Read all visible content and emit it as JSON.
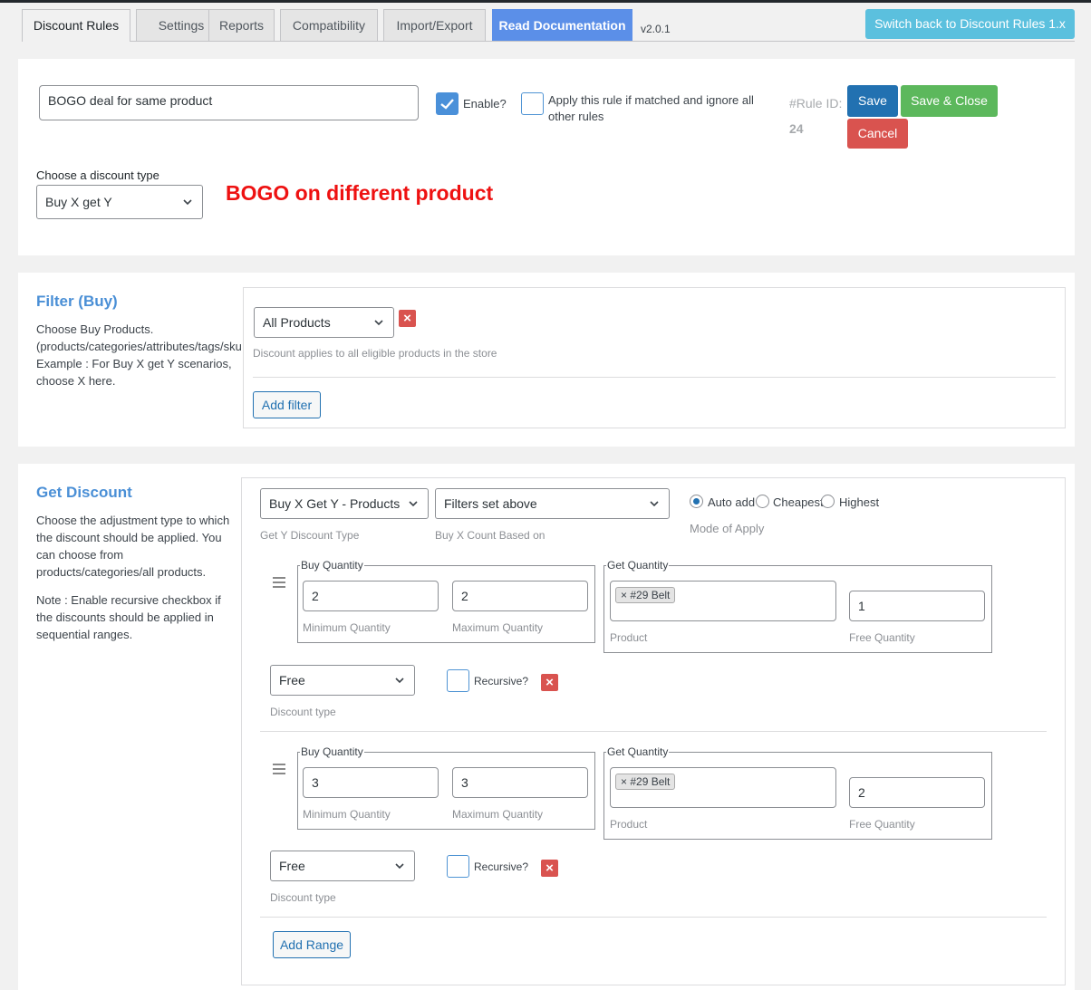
{
  "tabs": [
    {
      "label": "Discount Rules"
    },
    {
      "label": "Settings"
    },
    {
      "label": "Reports"
    },
    {
      "label": "Compatibility"
    },
    {
      "label": "Import/Export"
    },
    {
      "label": "Read Documentation"
    }
  ],
  "version": "v2.0.1",
  "switch_label": "Switch back to Discount Rules 1.x",
  "rule": {
    "name_value": "BOGO deal for same product",
    "enable_label": "Enable?",
    "enabled": true,
    "exclusive_label": "Apply this rule if matched and ignore all other rules",
    "rule_id_label": "#Rule ID:",
    "rule_id": "24",
    "save_label": "Save",
    "save_close_label": "Save & Close",
    "cancel_label": "Cancel",
    "discount_type_label": "Choose a discount type",
    "discount_type_value": "Buy X get Y",
    "annotation": "BOGO on different product",
    "annotation_color": "#ee1111"
  },
  "filter": {
    "title": "Filter (Buy)",
    "desc_1": "Choose Buy Products.",
    "desc_2": "(products/categories/attributes/tags/sku",
    "desc_3": "Example : For Buy X get Y scenarios,",
    "desc_4": "choose X here.",
    "select_value": "All Products",
    "hint": "Discount applies to all eligible products in the store",
    "add_label": "Add filter"
  },
  "get_discount": {
    "title": "Get Discount",
    "desc": "Choose the adjustment type to which\nthe discount should be applied. You\ncan choose from\nproducts/categories/all products.",
    "note": "Note : Enable recursive checkbox if\nthe discounts should be applied in\nsequential ranges.",
    "type_value": "Buy X Get Y - Products",
    "type_hint": "Get Y Discount Type",
    "count_value": "Filters set above",
    "count_hint": "Buy X Count Based on",
    "modes": [
      "Auto add",
      "Cheapest",
      "Highest"
    ],
    "mode_selected": "Auto add",
    "mode_hint": "Mode of Apply",
    "buy_qty_legend": "Buy Quantity",
    "get_qty_legend": "Get Quantity",
    "min_hint": "Minimum Quantity",
    "max_hint": "Maximum Quantity",
    "product_hint": "Product",
    "free_qty_hint": "Free Quantity",
    "discount_type_hint": "Discount type",
    "recursive_label": "Recursive?",
    "ranges": [
      {
        "min": "2",
        "max": "2",
        "product": "#29 Belt",
        "free_qty": "1",
        "discount_type": "Free"
      },
      {
        "min": "3",
        "max": "3",
        "product": "#29 Belt",
        "free_qty": "2",
        "discount_type": "Free"
      }
    ],
    "add_range_label": "Add Range"
  },
  "icons": {
    "chevron": "chevron-down-icon",
    "check": "checkmark-icon",
    "remove": "close-icon",
    "drag": "drag-handle-icon"
  }
}
